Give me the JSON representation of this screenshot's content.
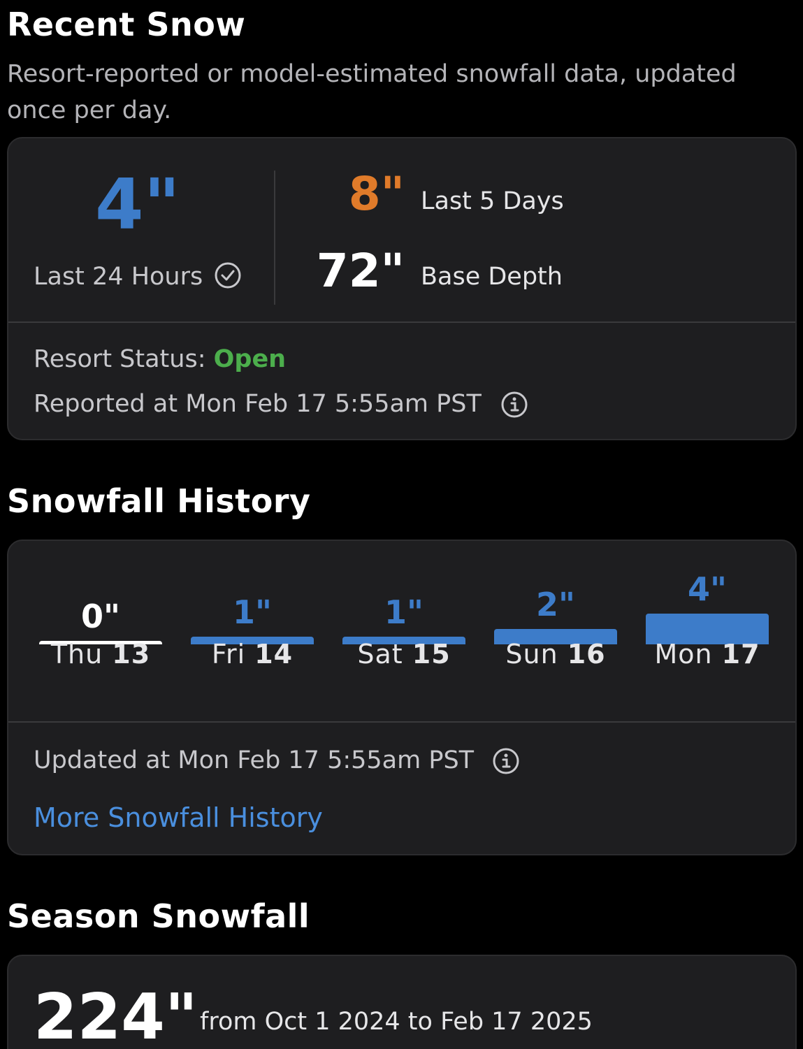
{
  "recent_snow": {
    "title": "Recent Snow",
    "subtitle": "Resort-reported or model-estimated snowfall data, updated once per day.",
    "last24_value": "4\"",
    "last24_label": "Last 24 Hours",
    "last5_value": "8\"",
    "last5_label": "Last 5 Days",
    "base_value": "72\"",
    "base_label": "Base Depth",
    "status_label": "Resort Status:",
    "status_value": "Open",
    "reported": "Reported at Mon Feb 17 5:55am PST"
  },
  "history": {
    "title": "Snowfall History",
    "days": [
      {
        "value": "0\"",
        "dow": "Thu",
        "date": "13",
        "inches": 0
      },
      {
        "value": "1\"",
        "dow": "Fri",
        "date": "14",
        "inches": 1
      },
      {
        "value": "1\"",
        "dow": "Sat",
        "date": "15",
        "inches": 1
      },
      {
        "value": "2\"",
        "dow": "Sun",
        "date": "16",
        "inches": 2
      },
      {
        "value": "4\"",
        "dow": "Mon",
        "date": "17",
        "inches": 4
      }
    ],
    "updated": "Updated at Mon Feb 17 5:55am PST",
    "more_link": "More Snowfall History"
  },
  "season": {
    "title": "Season Snowfall",
    "value": "224\"",
    "range": "from Oct 1 2024 to Feb 17 2025"
  },
  "colors": {
    "accent_blue": "#3d7cc9",
    "accent_orange": "#e07b2a",
    "status_green": "#4cae4c",
    "link_blue": "#4a8fde"
  },
  "icons": {
    "verified": "check-circle-icon",
    "info": "info-icon"
  }
}
